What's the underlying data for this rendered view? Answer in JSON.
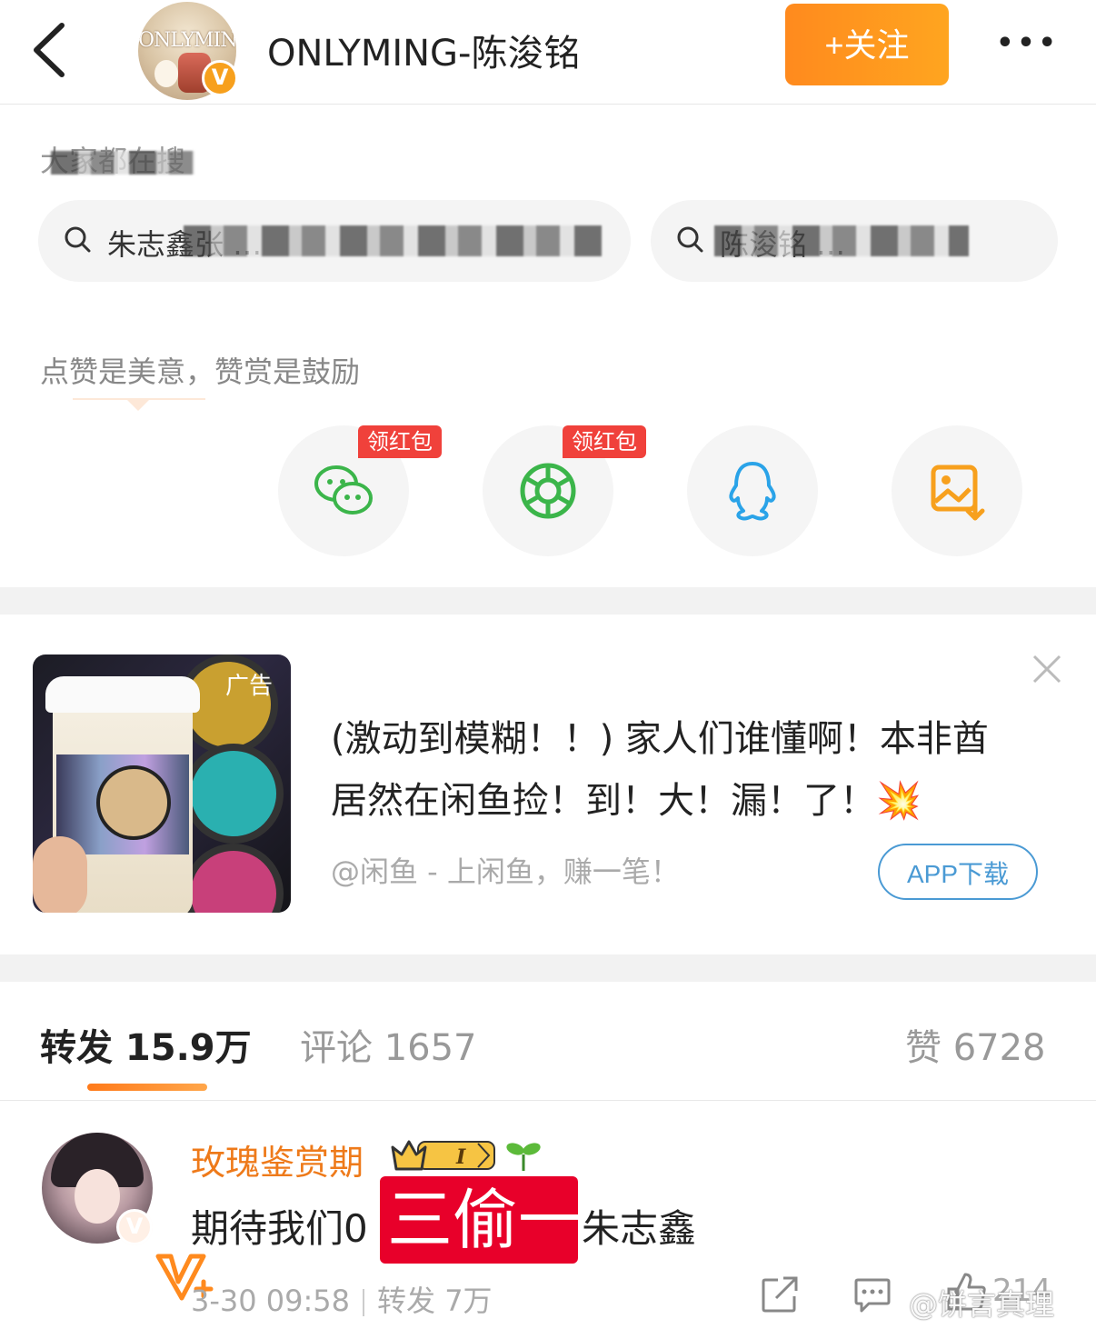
{
  "header": {
    "back_icon": "chevron-left-icon",
    "avatar_text": "ONLYMING",
    "verified_badge": "V",
    "title": "ONLYMING-陈浚铭",
    "follow_label": "+关注",
    "more_icon": "•••"
  },
  "search": {
    "section_label": "大家都在搜",
    "items": [
      {
        "text": "朱志鑫张 …"
      },
      {
        "text": "陈浚铭 …"
      }
    ]
  },
  "reward": {
    "label": "点赞是美意，赞赏是鼓励",
    "share_targets": [
      {
        "name": "v-plus-icon"
      },
      {
        "name": "wechat-icon",
        "tag": "领红包"
      },
      {
        "name": "moments-icon",
        "tag": "领红包"
      },
      {
        "name": "qq-icon"
      },
      {
        "name": "save-image-icon"
      }
    ]
  },
  "ad": {
    "tag": "广告",
    "line1": "(激动到模糊！！) 家人们谁懂啊！本非酋",
    "line2": "居然在闲鱼捡！到！大！漏！了！💥",
    "source": "@闲鱼 - 上闲鱼，赚一笔！",
    "button": "APP下载"
  },
  "tabs": {
    "repost": "转发 15.9万",
    "comment": "评论 1657",
    "like": "赞 6728"
  },
  "comment": {
    "username": "玫瑰鉴赏期",
    "verified_badge": "V",
    "text_before": "期待我们0",
    "text_highlight": "三偷一",
    "text_after": "朱志鑫",
    "date": "3-30 09:58",
    "reposts": "转发 7万",
    "likes": "214",
    "watermark": "@饼言真理"
  },
  "colors": {
    "accent_orange": "#ff8a1e",
    "follow_button": "#ffa51f",
    "red_tag": "#f0413b",
    "link_blue": "#4a9ad4",
    "username_orange": "#ee7a1a"
  }
}
